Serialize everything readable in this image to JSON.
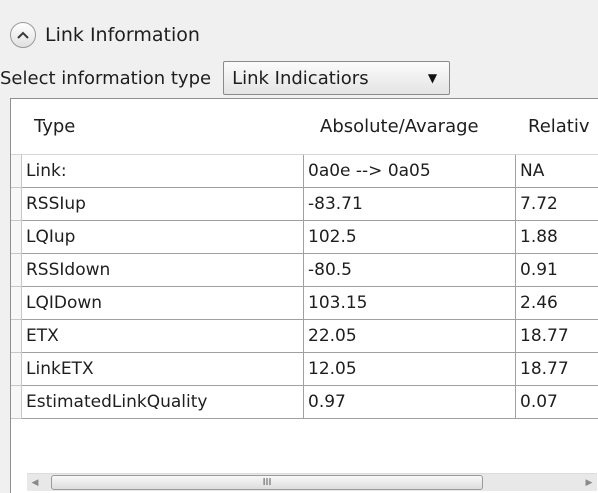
{
  "panel": {
    "title": "Link Information",
    "expand_icon": "chevron-up-icon"
  },
  "selector": {
    "label": "Select information type",
    "value": "Link Indicatiors"
  },
  "table": {
    "columns": [
      "Type",
      "Absolute/Avarage",
      "Relativ"
    ],
    "rows": [
      [
        "Link:",
        "0a0e --> 0a05",
        "NA"
      ],
      [
        "RSSIup",
        "-83.71",
        "7.72"
      ],
      [
        "LQIup",
        "102.5",
        "1.88"
      ],
      [
        "RSSIdown",
        "-80.5",
        "0.91"
      ],
      [
        "LQIDown",
        "103.15",
        "2.46"
      ],
      [
        "ETX",
        "22.05",
        "18.77"
      ],
      [
        "LinkETX",
        "12.05",
        "18.77"
      ],
      [
        "EstimatedLinkQuality",
        "0.97",
        "0.07"
      ]
    ]
  },
  "scrollbar": {
    "thumb_grip": "III",
    "left_icon": "scroll-left-icon",
    "right_icon": "scroll-right-icon"
  }
}
